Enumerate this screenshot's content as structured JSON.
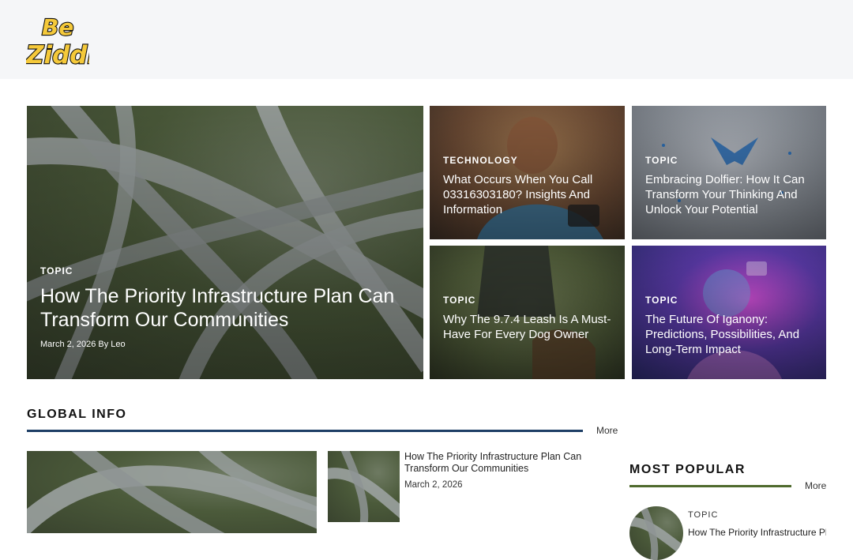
{
  "brand": {
    "line1": "Be",
    "line2": "Ziddi",
    "color": "#f5c93a"
  },
  "hero": {
    "category": "TOPIC",
    "title": "How The Priority Infrastructure Plan Can Transform Our Communities",
    "meta": "March 2, 2026 By Leo"
  },
  "grid": [
    {
      "category": "TECHNOLOGY",
      "title": "What Occurs When You Call 03316303180? Insights And Information"
    },
    {
      "category": "TOPIC",
      "title": "Embracing Dolfier: How It Can Transform Your Thinking And Unlock Your Potential"
    },
    {
      "category": "TOPIC",
      "title": "Why The 9.7.4 Leash Is A Must-Have For Every Dog Owner"
    },
    {
      "category": "TOPIC",
      "title": "The Future Of Iganony: Predictions, Possibilities, And Long-Term Impact"
    }
  ],
  "global": {
    "heading": "GLOBAL INFO",
    "more": "More",
    "rule_color": "#1e3f66",
    "item": {
      "title": "How The Priority Infrastructure Plan Can Transform Our Communities",
      "date": "March 2, 2026"
    }
  },
  "popular": {
    "heading": "MOST POPULAR",
    "more": "More",
    "rule_color": "#4f6a2e",
    "item": {
      "category": "TOPIC",
      "title": "How The Priority Infrastructure Plan Can Transform Our Communities"
    }
  }
}
